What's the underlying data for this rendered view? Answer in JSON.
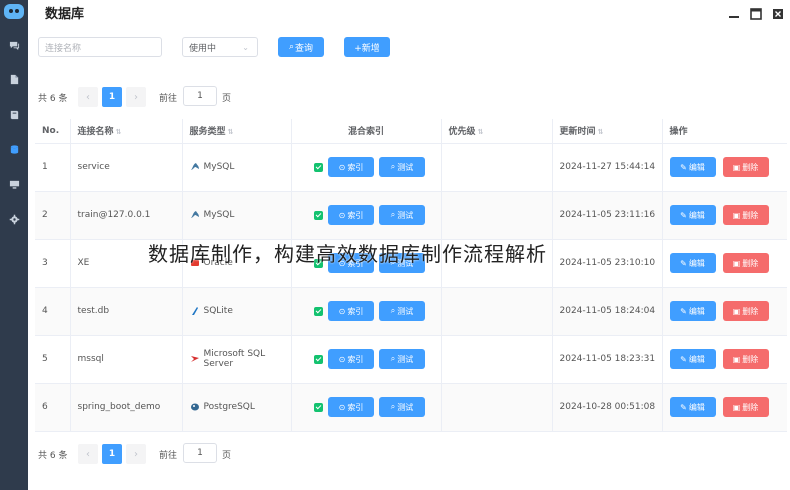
{
  "window": {
    "title": "数据库"
  },
  "sidebar": {
    "items": [
      {
        "icon": "logo-icon"
      },
      {
        "icon": "chat-icon"
      },
      {
        "icon": "document-icon"
      },
      {
        "icon": "book-icon"
      },
      {
        "icon": "database-icon"
      },
      {
        "icon": "monitor-icon"
      },
      {
        "icon": "gear-icon"
      }
    ]
  },
  "toolbar": {
    "search_placeholder": "连接名称",
    "status_select": "使用中",
    "query_label": "查询",
    "add_label": "+新增"
  },
  "pagination": {
    "total": "共 6 条",
    "current_page": "1",
    "goto_label": "前往",
    "goto_value": "1",
    "page_label": "页"
  },
  "table": {
    "headers": {
      "no": "No.",
      "name": "连接名称",
      "service": "服务类型",
      "index": "混合索引",
      "priority": "优先级",
      "updated": "更新时间",
      "actions": "操作"
    },
    "index_button": "索引",
    "test_button": "测试",
    "edit_button": "编辑",
    "delete_button": "删除",
    "rows": [
      {
        "no": "1",
        "name": "service",
        "service": "MySQL",
        "service_icon": "mysql-icon",
        "updated": "2024-11-27 15:44:14"
      },
      {
        "no": "2",
        "name": "train@127.0.0.1",
        "service": "MySQL",
        "service_icon": "mysql-icon",
        "updated": "2024-11-05 23:11:16"
      },
      {
        "no": "3",
        "name": "XE",
        "service": "Oracle",
        "service_icon": "oracle-icon",
        "updated": "2024-11-05 23:10:10"
      },
      {
        "no": "4",
        "name": "test.db",
        "service": "SQLite",
        "service_icon": "sqlite-icon",
        "updated": "2024-11-05 18:24:04"
      },
      {
        "no": "5",
        "name": "mssql",
        "service": "Microsoft SQL Server",
        "service_icon": "mssql-icon",
        "updated": "2024-11-05 18:23:31"
      },
      {
        "no": "6",
        "name": "spring_boot_demo",
        "service": "PostgreSQL",
        "service_icon": "postgresql-icon",
        "updated": "2024-10-28 00:51:08"
      }
    ]
  },
  "overlay_caption": "数据库制作，构建高效数据库制作流程解析",
  "colors": {
    "primary": "#409eff",
    "danger": "#f56c6c",
    "sidebar": "#2f3b4c",
    "success": "#13c26f"
  }
}
